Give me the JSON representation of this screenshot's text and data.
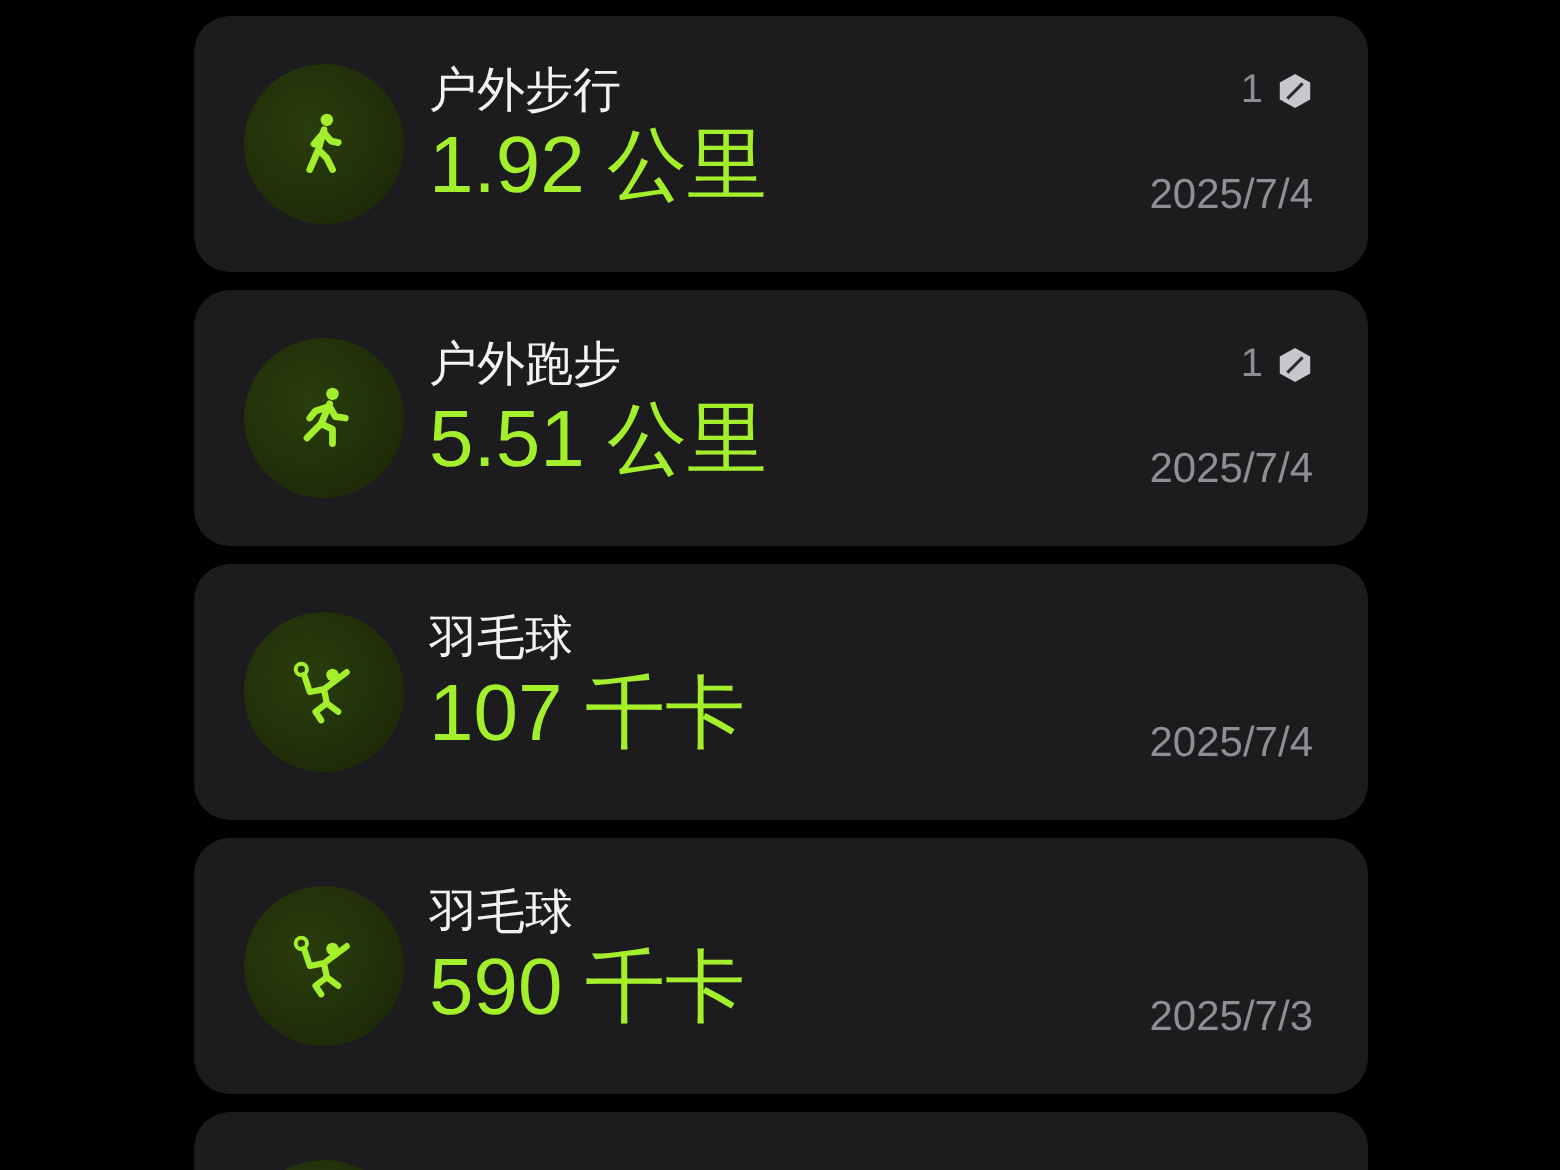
{
  "workouts": [
    {
      "kind": "walk",
      "title": "户外步行",
      "value": "1.92 公里",
      "badge": "1",
      "date": "2025/7/4"
    },
    {
      "kind": "run",
      "title": "户外跑步",
      "value": "5.51 公里",
      "badge": "1",
      "date": "2025/7/4"
    },
    {
      "kind": "badminton",
      "title": "羽毛球",
      "value": "107 千卡",
      "date": "2025/7/4"
    },
    {
      "kind": "badminton",
      "title": "羽毛球",
      "value": "590 千卡",
      "date": "2025/7/3"
    }
  ],
  "list_continues": true
}
